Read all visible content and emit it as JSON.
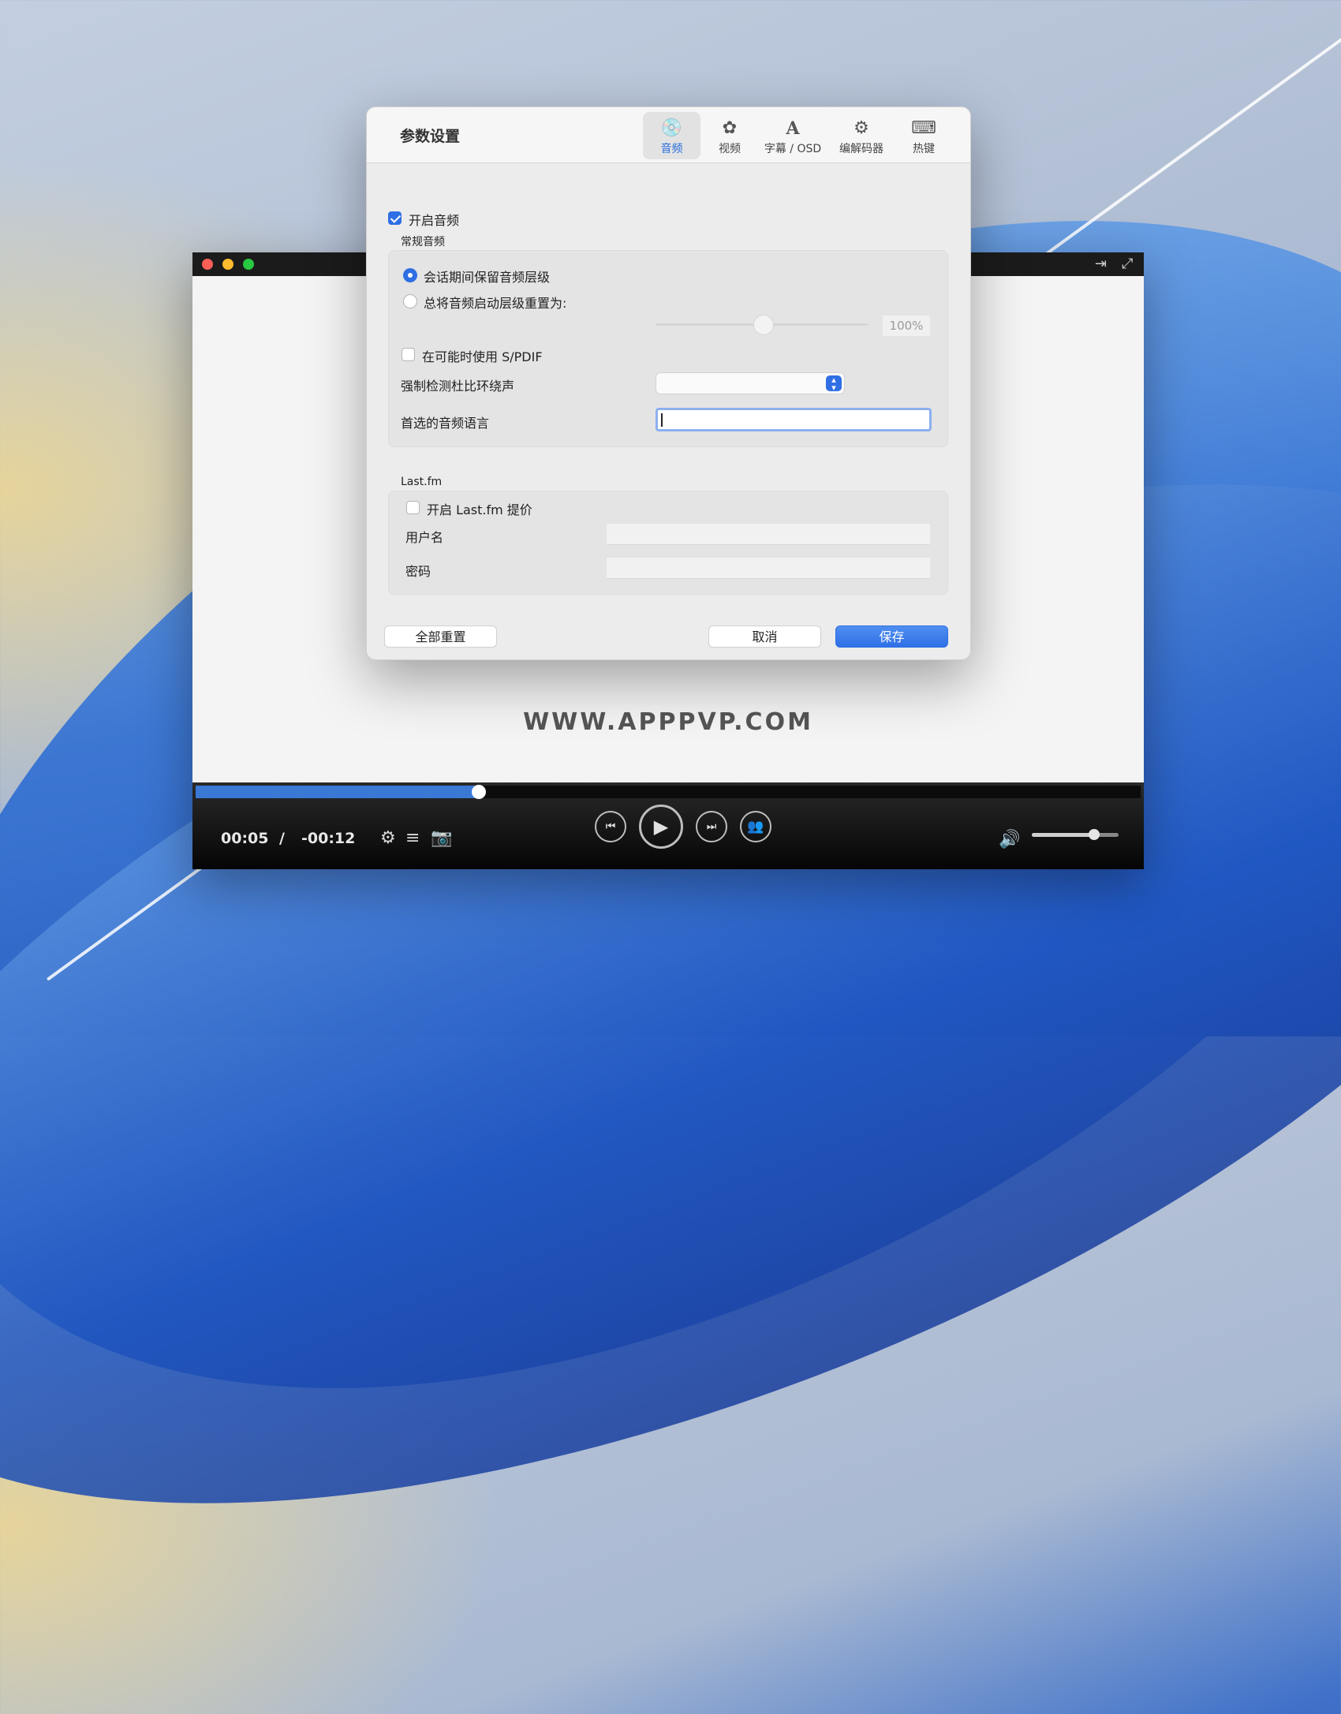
{
  "player": {
    "elapsed": "00:05",
    "separator": "/",
    "remaining": "-00:12",
    "watermark": "WWW.APPPVP.COM",
    "progress_fraction": 0.3,
    "volume_fraction": 0.72
  },
  "dialog": {
    "title": "参数设置",
    "tabs": [
      {
        "label": "音频",
        "icon": "audio-icon",
        "active": true
      },
      {
        "label": "视频",
        "icon": "film-reel-icon",
        "active": false
      },
      {
        "label": "字幕 / OSD",
        "icon": "font-a-icon",
        "active": false
      },
      {
        "label": "编解码器",
        "icon": "codec-box-icon",
        "active": false
      },
      {
        "label": "热键",
        "icon": "keyboard-icon",
        "active": false
      }
    ],
    "audio": {
      "enable_audio_label": "开启音频",
      "enable_audio_checked": true,
      "general_section": "常规音频",
      "radio_keep_level": "会话期间保留音频层级",
      "radio_reset_level": "总将音频启动层级重置为:",
      "reset_level_value": "100%",
      "spdif_label": "在可能时使用 S/PDIF",
      "dolby_label": "强制检测杜比环绕声",
      "preferred_language_label": "首选的音频语言",
      "preferred_language_value": ""
    },
    "lastfm": {
      "section": "Last.fm",
      "enable_label": "开启 Last.fm 提价",
      "username_label": "用户名",
      "password_label": "密码"
    },
    "buttons": {
      "reset_all": "全部重置",
      "cancel": "取消",
      "save": "保存"
    }
  },
  "colors": {
    "accent": "#2f6fe4",
    "progress": "#3a78d6"
  }
}
